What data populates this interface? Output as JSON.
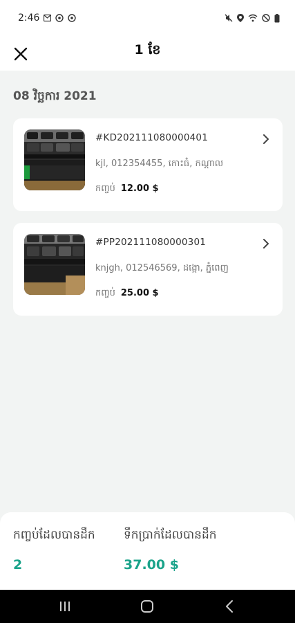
{
  "status_bar": {
    "time": "2:46",
    "left_icons": [
      "mail-icon",
      "data-saver-icon",
      "data-saver-icon"
    ],
    "right_icons": [
      "mute-icon",
      "location-icon",
      "wifi-icon",
      "dnd-icon",
      "battery-icon"
    ]
  },
  "header": {
    "title": "1 ខែ"
  },
  "date_header": "08 វិច្ឆការ 2021",
  "orders": [
    {
      "id": "#KD202111080000401",
      "address": "kjl, 012354455, កោះធំ, កណ្តាល",
      "price_label": "កញ្ចប់",
      "price": "12.00 $"
    },
    {
      "id": "#PP202111080000301",
      "address": "knjgh, 012546569, ដង្កោ, ភ្នំពេញ",
      "price_label": "កញ្ចប់",
      "price": "25.00 $"
    }
  ],
  "summary": {
    "packages_label": "កញ្ចប់ដែលបានដឹក",
    "packages_value": "2",
    "amount_label": "ទឹកប្រាក់ដែលបានដឹក",
    "amount_value": "37.00 $"
  },
  "colors": {
    "accent": "#1aa38a",
    "background": "#f2f4f3"
  },
  "nav": [
    "recents-icon",
    "home-icon",
    "back-icon"
  ]
}
